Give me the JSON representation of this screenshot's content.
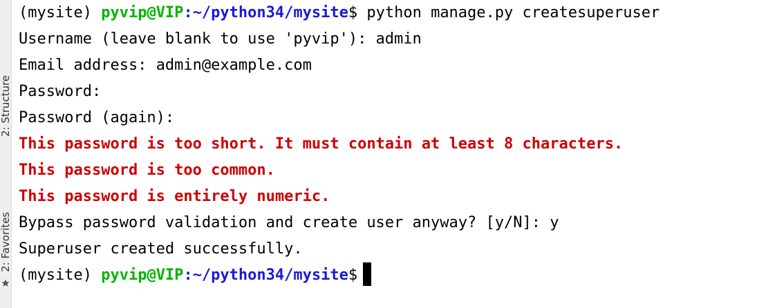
{
  "sidebar": {
    "tabs": [
      {
        "label": "2: Structure"
      },
      {
        "label": "2: Favorites"
      }
    ],
    "icon": "star-icon"
  },
  "terminal": {
    "prompt": {
      "env": "(mysite) ",
      "user_host": "pyvip@VIP",
      "separator": ":",
      "path": "~/python34/mysite",
      "dollar": "$"
    },
    "command": " python manage.py createsuperuser",
    "lines": [
      "Username (leave blank to use 'pyvip'): admin",
      "Email address: admin@example.com",
      "Password:",
      "Password (again):"
    ],
    "errors": [
      "This password is too short. It must contain at least 8 characters.",
      "This password is too common.",
      "This password is entirely numeric."
    ],
    "confirm_line": "Bypass password validation and create user anyway? [y/N]: y",
    "success_line": "Superuser created successfully."
  },
  "colors": {
    "prompt_user": "#00b400",
    "prompt_path": "#1a1ad6",
    "error": "#cc0000"
  }
}
